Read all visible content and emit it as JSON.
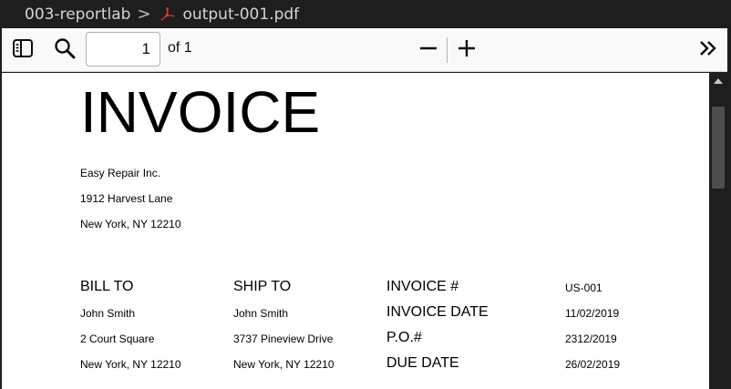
{
  "breadcrumb": {
    "folder": "003-reportlab",
    "separator": ">",
    "file": "output-001.pdf"
  },
  "toolbar": {
    "page_value": "1",
    "page_count": "of 1"
  },
  "colors": {
    "pdf_icon": "#e0383b",
    "titlebar_bg": "#1e1e1e",
    "toolbar_bg": "#f9f9fa"
  },
  "icons": {
    "sidebar": "sidebar-toggle-icon",
    "search": "search-icon",
    "zoom_out": "minus-icon",
    "zoom_in": "plus-icon",
    "more": "double-chevron-right-icon"
  },
  "document": {
    "title": "INVOICE",
    "company": {
      "name": "Easy Repair Inc.",
      "street": "1912 Harvest Lane",
      "city": "New York, NY 12210"
    },
    "bill_to": {
      "label": "BILL TO",
      "name": "John Smith",
      "street": "2 Court Square",
      "city": "New York, NY 12210"
    },
    "ship_to": {
      "label": "SHIP TO",
      "name": "John Smith",
      "street": "3737 Pineview Drive",
      "city": "New York, NY 12210"
    },
    "meta": [
      {
        "label": "INVOICE #",
        "value": "US-001"
      },
      {
        "label": "INVOICE DATE",
        "value": "11/02/2019"
      },
      {
        "label": "P.O.#",
        "value": "2312/2019"
      },
      {
        "label": "DUE DATE",
        "value": "26/02/2019"
      }
    ]
  }
}
